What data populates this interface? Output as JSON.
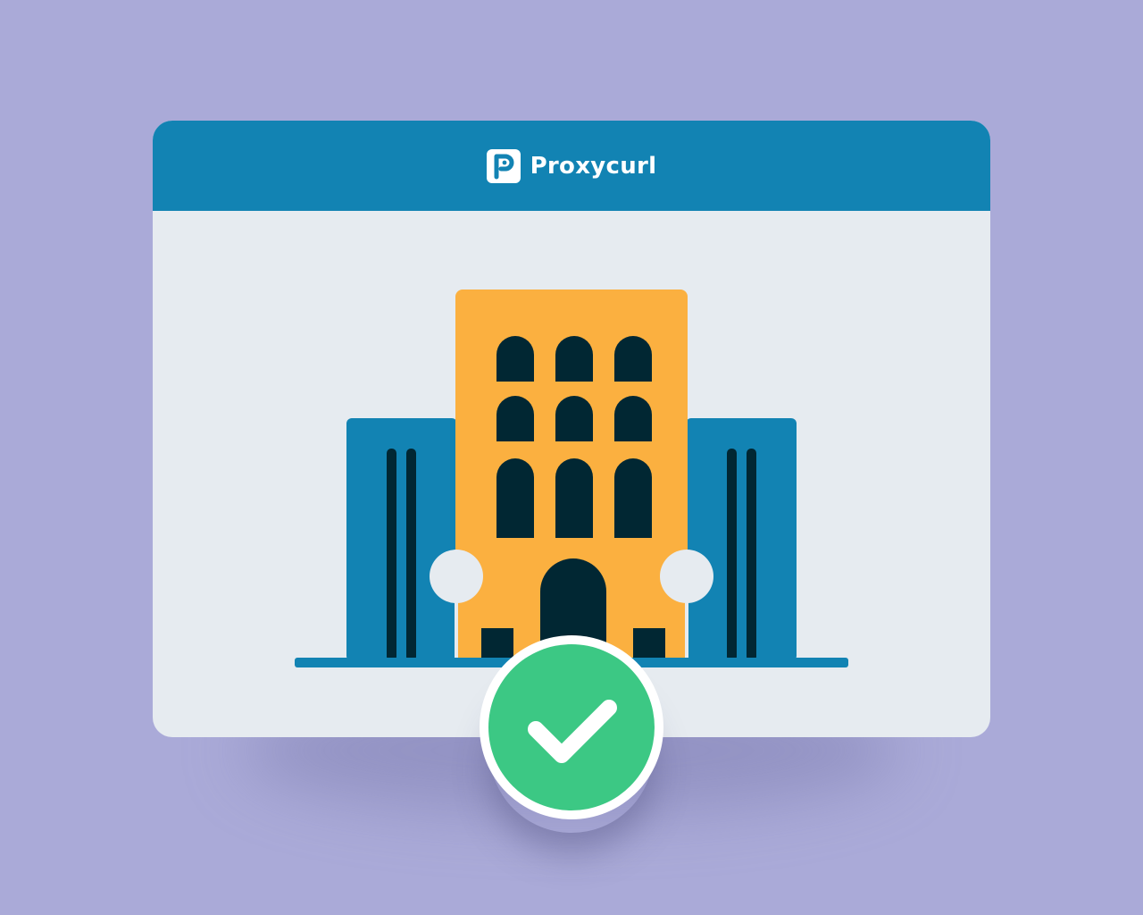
{
  "brand": {
    "name": "Proxycurl",
    "logo_icon": "proxycurl-p-logo"
  },
  "colors": {
    "background": "#aaaad8",
    "titlebar": "#1283b3",
    "window_body": "#e6ebf0",
    "building_main": "#fbb040",
    "building_side": "#1283b3",
    "window_dark": "#012733",
    "check_green": "#3cc884"
  },
  "badge": {
    "icon": "checkmark-icon"
  }
}
